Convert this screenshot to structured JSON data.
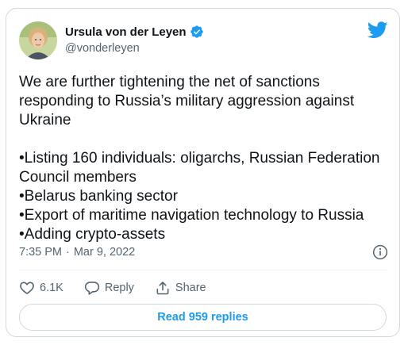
{
  "author": {
    "display_name": "Ursula von der Leyen",
    "handle": "@vonderleyen",
    "verified": true
  },
  "tweet": {
    "intro": "We are further tightening the net of sanctions responding to Russia’s military aggression against Ukraine",
    "bullets": [
      "•Listing 160 individuals: oligarchs, Russian Federation Council members",
      "•Belarus banking sector",
      "•Export of maritime navigation technology to Russia",
      "•Adding crypto-assets"
    ],
    "time": "7:35 PM",
    "separator": "·",
    "date": "Mar 9, 2022"
  },
  "actions": {
    "like_count": "6.1K",
    "reply_label": "Reply",
    "share_label": "Share"
  },
  "read_replies_label": "Read 959 replies",
  "colors": {
    "accent": "#1d9bf0",
    "secondary_text": "#536471",
    "border": "#cfd9de"
  },
  "icons": {
    "brand": "twitter-bird-icon",
    "verified": "verified-badge-icon",
    "info": "info-icon",
    "like": "heart-icon",
    "reply": "reply-bubble-icon",
    "share": "share-icon"
  }
}
